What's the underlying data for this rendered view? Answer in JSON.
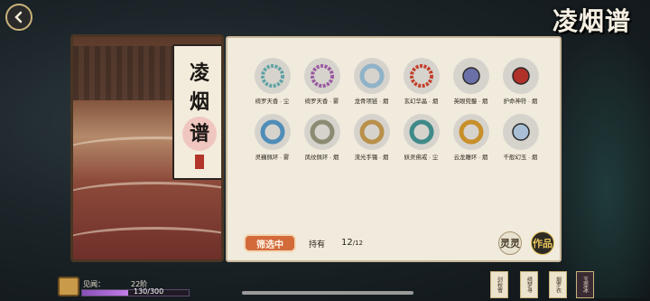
{
  "header": {
    "logo_text": "凌烟谱"
  },
  "scroll": {
    "chars": [
      "凌",
      "烟",
      "谱"
    ]
  },
  "colors": {
    "accent": "#d36a3a",
    "panel_bg": "#f1ebdd",
    "exp_fill": "#a25fd0"
  },
  "items": [
    {
      "label": "绮罗天香 · 尘",
      "icon": "bracelet-beads-icon",
      "tone": "#5fa3a4"
    },
    {
      "label": "绮罗天香 · 雾",
      "icon": "bracelet-beads-icon",
      "tone": "#9a5aa0"
    },
    {
      "label": "龙骨项链 · 烟",
      "icon": "necklace-icon",
      "tone": "#8fb3c8"
    },
    {
      "label": "玄幻华晶 · 烟",
      "icon": "bracelet-beads-icon",
      "tone": "#c2402a"
    },
    {
      "label": "英眼兜鍪 · 烟",
      "icon": "helmet-icon",
      "tone": "#6a6fa8"
    },
    {
      "label": "护命神符 · 烟",
      "icon": "pouch-icon",
      "tone": "#b0302a"
    },
    {
      "label": "灵巍佩环 · 雾",
      "icon": "jade-ring-icon",
      "tone": "#4f8db8"
    },
    {
      "label": "凤纹佩环 · 烟",
      "icon": "jade-disc-icon",
      "tone": "#8c8a72"
    },
    {
      "label": "流光手镯 · 烟",
      "icon": "bangle-icon",
      "tone": "#b8904a"
    },
    {
      "label": "妖灵佛戒 · 尘",
      "icon": "jade-bangle-icon",
      "tone": "#3f8a88"
    },
    {
      "label": "云龙雕环 · 烟",
      "icon": "gold-bangle-icon",
      "tone": "#c88f2a"
    },
    {
      "label": "千般幻玉 · 烟",
      "icon": "crystal-icon",
      "tone": "#a8bfd6"
    }
  ],
  "footer": {
    "filter_label": "筛选中",
    "owned_label": "持有",
    "owned_count": "12",
    "owned_total": "/12",
    "lingling_label": "灵灵",
    "zuopin_label": "作品"
  },
  "bottom": {
    "exp_label": "见闻：",
    "exp_level": "22阶",
    "exp_text": "130/300",
    "exp_fraction": 0.433
  },
  "tags": [
    "剑秋雪",
    "绮梦寻",
    "烟罗衣",
    "玉壶冰"
  ]
}
